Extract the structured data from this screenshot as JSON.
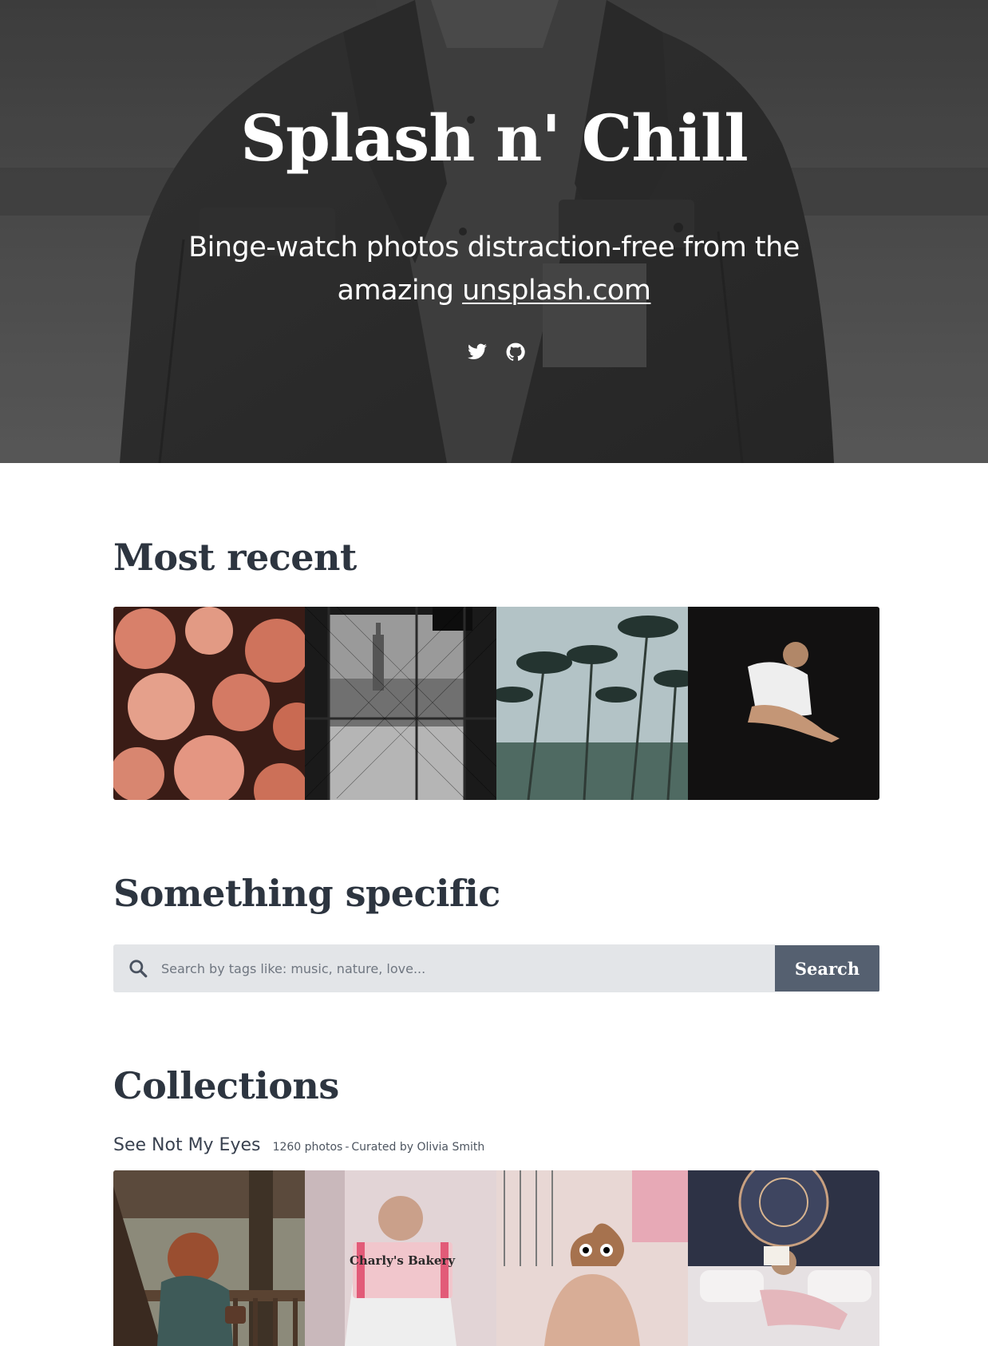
{
  "hero": {
    "title": "Splash n' Chill",
    "subtitle_prefix": "Binge-watch photos distraction-free from the amazing ",
    "subtitle_link": "unsplash.com",
    "social": [
      {
        "icon": "twitter-icon"
      },
      {
        "icon": "github-icon"
      }
    ]
  },
  "sections": {
    "recent_heading": "Most recent",
    "specific_heading": "Something specific",
    "collections_heading": "Collections"
  },
  "recent_photos": [
    {
      "subject": "coral flowers",
      "color": "#c86a52"
    },
    {
      "subject": "city through chain-link fence",
      "color": "#8a8a8a"
    },
    {
      "subject": "palm trees against grey sky",
      "color": "#b4c3c6"
    },
    {
      "subject": "woman sitting in dark",
      "color": "#141414"
    }
  ],
  "search": {
    "placeholder": "Search by tags like: music, nature, love...",
    "button_label": "Search"
  },
  "collection": {
    "name": "See Not My Eyes",
    "photo_count": "1260 photos",
    "separator": "-",
    "curator": "Curated by Olivia Smith",
    "photos": [
      {
        "subject": "woman on porch",
        "color": "#6f5a48"
      },
      {
        "subject": "Charly's Bakery box",
        "color": "#d9c3c8"
      },
      {
        "subject": "poop emoji cookie",
        "color": "#caa48c"
      },
      {
        "subject": "woman reading on bed",
        "color": "#d8d2d2"
      }
    ],
    "bakery_label": "Charly's Bakery"
  },
  "colors": {
    "heading": "#2d3540",
    "search_field_bg": "#e3e5e8",
    "search_button_bg": "#556070"
  }
}
